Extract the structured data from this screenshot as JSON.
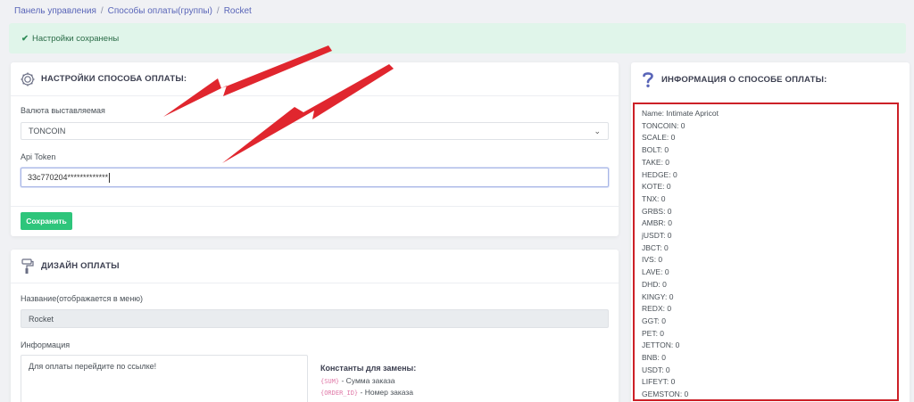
{
  "breadcrumb": {
    "items": [
      "Панель управления",
      "Способы оплаты(группы)",
      "Rocket"
    ],
    "separator": "/"
  },
  "alert": {
    "text": "Настройки сохранены"
  },
  "settings_card": {
    "title": "НАСТРОЙКИ СПОСОБА ОПЛАТЫ:",
    "icon": "gear-icon",
    "currency_label": "Валюта выставляемая",
    "currency_value": "TONCOIN",
    "token_label": "Api Token",
    "token_value": "33c770204*************",
    "save_label": "Сохранить"
  },
  "design_card": {
    "title": "ДИЗАЙН ОПЛАТЫ",
    "icon": "paint-roller-icon",
    "name_label": "Название(отображается в меню)",
    "name_value": "Rocket",
    "info_label": "Информация",
    "info_value": "Для оплаты перейдите по ссылке!",
    "constants_title": "Константы для замены:",
    "constants": [
      {
        "code": "{SUM}",
        "desc": "- Сумма заказа"
      },
      {
        "code": "{ORDER_ID}",
        "desc": "- Номер заказа"
      }
    ]
  },
  "info_card": {
    "title": "ИНФОРМАЦИЯ О СПОСОБЕ ОПЛАТЫ:",
    "icon": "question-icon",
    "lines": [
      "Name: Intimate Apricot",
      "TONCOIN: 0",
      "SCALE: 0",
      "BOLT: 0",
      "TAKE: 0",
      "HEDGE: 0",
      "KOTE: 0",
      "TNX: 0",
      "GRBS: 0",
      "AMBR: 0",
      "jUSDT: 0",
      "JBCT: 0",
      "IVS: 0",
      "LAVE: 0",
      "DHD: 0",
      "KINGY: 0",
      "REDX: 0",
      "GGT: 0",
      "PET: 0",
      "JETTON: 0",
      "BNB: 0",
      "USDT: 0",
      "LIFEYT: 0",
      "GEMSTON: 0"
    ]
  },
  "colors": {
    "accent": "#5965b8",
    "success": "#2ec57b",
    "alert_bg": "#e0f5ea",
    "highlight_border": "#cc2027",
    "annotation_arrow": "#e0262e"
  }
}
